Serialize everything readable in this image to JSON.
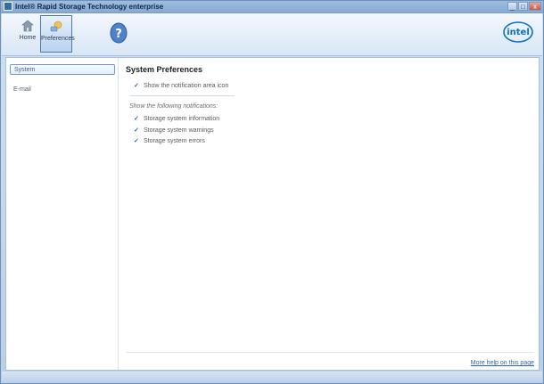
{
  "window": {
    "title": "Intel® Rapid Storage Technology enterprise",
    "controls": {
      "minimize": "_",
      "maximize": "□",
      "close": "x"
    }
  },
  "toolbar": {
    "home_label": "Home",
    "preferences_label": "Preferences",
    "help_icon": "help-icon",
    "logo_text": "intel"
  },
  "nav": {
    "items": [
      {
        "label": "System"
      },
      {
        "label": "E-mail"
      }
    ]
  },
  "main": {
    "title": "System Preferences",
    "show_icon_option": "Show the notification area icon",
    "notifications_heading": "Show the following notifications:",
    "notifications": [
      {
        "label": "Storage system information"
      },
      {
        "label": "Storage system warnings"
      },
      {
        "label": "Storage system errors"
      }
    ],
    "help_link": "More help on this page"
  },
  "colors": {
    "accent": "#2e66b5",
    "selected_nav_border": "#6d98cf"
  }
}
